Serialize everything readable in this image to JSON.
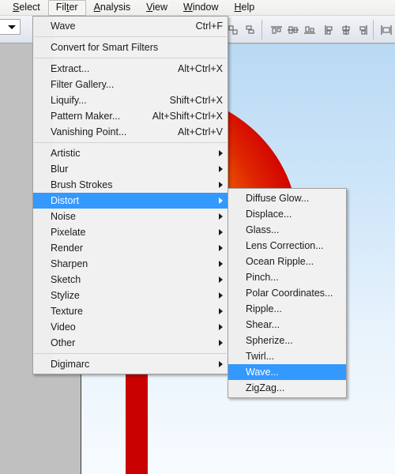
{
  "menubar": {
    "items": [
      {
        "label": "Select",
        "accel": "S",
        "active": false
      },
      {
        "label": "Filter",
        "accel": "t",
        "active": true
      },
      {
        "label": "Analysis",
        "accel": "A",
        "active": false
      },
      {
        "label": "View",
        "accel": "V",
        "active": false
      },
      {
        "label": "Window",
        "accel": "W",
        "active": false
      },
      {
        "label": "Help",
        "accel": "H",
        "active": false
      }
    ]
  },
  "options_bar": {
    "dropdown_value": "",
    "icons": [
      "align-link-icon",
      "align-layers-icon",
      "align-top-edges-icon",
      "align-vertical-centers-icon",
      "align-bottom-edges-icon",
      "align-left-edges-icon",
      "align-horizontal-centers-icon",
      "align-right-edges-icon",
      "distribute-icon"
    ]
  },
  "filter_menu": {
    "name": "Filter",
    "items": [
      {
        "type": "item",
        "label": "Wave",
        "accel": "Ctrl+F",
        "submenu": false,
        "selected": false
      },
      {
        "type": "separator"
      },
      {
        "type": "item",
        "label": "Convert for Smart Filters",
        "accel": "",
        "submenu": false,
        "selected": false
      },
      {
        "type": "separator"
      },
      {
        "type": "item",
        "label": "Extract...",
        "accel": "Alt+Ctrl+X",
        "submenu": false,
        "selected": false
      },
      {
        "type": "item",
        "label": "Filter Gallery...",
        "accel": "",
        "submenu": false,
        "selected": false
      },
      {
        "type": "item",
        "label": "Liquify...",
        "accel": "Shift+Ctrl+X",
        "submenu": false,
        "selected": false
      },
      {
        "type": "item",
        "label": "Pattern Maker...",
        "accel": "Alt+Shift+Ctrl+X",
        "submenu": false,
        "selected": false
      },
      {
        "type": "item",
        "label": "Vanishing Point...",
        "accel": "Alt+Ctrl+V",
        "submenu": false,
        "selected": false
      },
      {
        "type": "separator"
      },
      {
        "type": "item",
        "label": "Artistic",
        "accel": "",
        "submenu": true,
        "selected": false
      },
      {
        "type": "item",
        "label": "Blur",
        "accel": "",
        "submenu": true,
        "selected": false
      },
      {
        "type": "item",
        "label": "Brush Strokes",
        "accel": "",
        "submenu": true,
        "selected": false
      },
      {
        "type": "item",
        "label": "Distort",
        "accel": "",
        "submenu": true,
        "selected": true
      },
      {
        "type": "item",
        "label": "Noise",
        "accel": "",
        "submenu": true,
        "selected": false
      },
      {
        "type": "item",
        "label": "Pixelate",
        "accel": "",
        "submenu": true,
        "selected": false
      },
      {
        "type": "item",
        "label": "Render",
        "accel": "",
        "submenu": true,
        "selected": false
      },
      {
        "type": "item",
        "label": "Sharpen",
        "accel": "",
        "submenu": true,
        "selected": false
      },
      {
        "type": "item",
        "label": "Sketch",
        "accel": "",
        "submenu": true,
        "selected": false
      },
      {
        "type": "item",
        "label": "Stylize",
        "accel": "",
        "submenu": true,
        "selected": false
      },
      {
        "type": "item",
        "label": "Texture",
        "accel": "",
        "submenu": true,
        "selected": false
      },
      {
        "type": "item",
        "label": "Video",
        "accel": "",
        "submenu": true,
        "selected": false
      },
      {
        "type": "item",
        "label": "Other",
        "accel": "",
        "submenu": true,
        "selected": false
      },
      {
        "type": "separator"
      },
      {
        "type": "item",
        "label": "Digimarc",
        "accel": "",
        "submenu": true,
        "selected": false
      }
    ]
  },
  "distort_menu": {
    "name": "Distort",
    "items": [
      {
        "type": "item",
        "label": "Diffuse Glow...",
        "selected": false
      },
      {
        "type": "item",
        "label": "Displace...",
        "selected": false
      },
      {
        "type": "item",
        "label": "Glass...",
        "selected": false
      },
      {
        "type": "item",
        "label": "Lens Correction...",
        "selected": false
      },
      {
        "type": "item",
        "label": "Ocean Ripple...",
        "selected": false
      },
      {
        "type": "item",
        "label": "Pinch...",
        "selected": false
      },
      {
        "type": "item",
        "label": "Polar Coordinates...",
        "selected": false
      },
      {
        "type": "item",
        "label": "Ripple...",
        "selected": false
      },
      {
        "type": "item",
        "label": "Shear...",
        "selected": false
      },
      {
        "type": "item",
        "label": "Spherize...",
        "selected": false
      },
      {
        "type": "item",
        "label": "Twirl...",
        "selected": false
      },
      {
        "type": "item",
        "label": "Wave...",
        "selected": true
      },
      {
        "type": "item",
        "label": "ZigZag...",
        "selected": false
      }
    ]
  },
  "canvas": {
    "artwork_name": "lollipop-illustration",
    "background_color": "#cfe6f9",
    "ball_colors": [
      "#ffffff",
      "#ffe000",
      "#ffb000",
      "#f07000",
      "#d00000"
    ],
    "stick_color": "#c90000",
    "highlight_color": "#ffffff"
  },
  "colors": {
    "menu_highlight": "#3399ff",
    "menu_background": "#f1f1f1",
    "app_background": "#c0c0c0"
  }
}
